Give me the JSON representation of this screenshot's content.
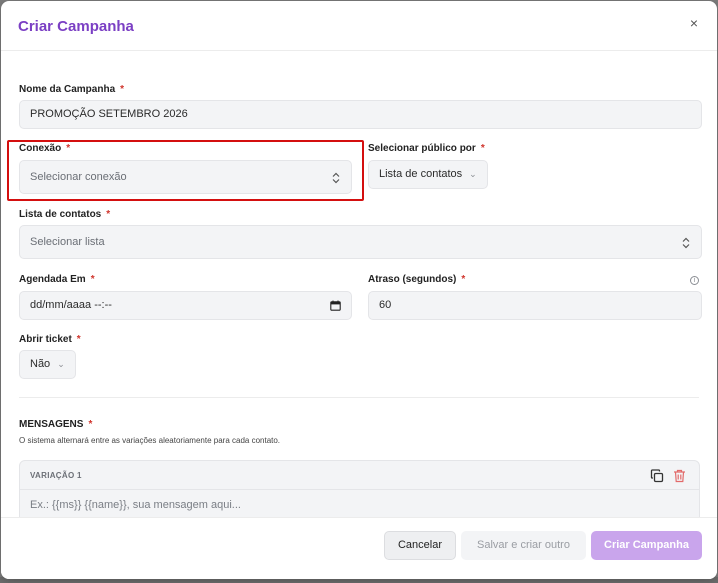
{
  "modal": {
    "title": "Criar Campanha",
    "close_label": "×"
  },
  "form": {
    "campaign_name": {
      "label": "Nome da Campanha",
      "required": "*",
      "value": "PROMOÇÃO SETEMBRO 2026"
    },
    "connection": {
      "label": "Conexão",
      "required": "*",
      "placeholder": "Selecionar conexão"
    },
    "audience_by": {
      "label": "Selecionar público por",
      "required": "*",
      "value": "Lista de contatos"
    },
    "contact_list": {
      "label": "Lista de contatos",
      "required": "*",
      "placeholder": "Selecionar lista"
    },
    "scheduled_at": {
      "label": "Agendada Em",
      "required": "*",
      "placeholder": "dd/mm/aaaa --:--"
    },
    "delay": {
      "label": "Atraso (segundos)",
      "required": "*",
      "value": "60",
      "info": "i"
    },
    "open_ticket": {
      "label": "Abrir ticket",
      "required": "*",
      "value": "Não"
    }
  },
  "messages": {
    "title": "MENSAGENS",
    "required": "*",
    "description": "O sistema alternará entre as variações aleatoriamente para cada contato.",
    "variations": [
      {
        "title": "VARIAÇÃO 1",
        "placeholder": "Ex.: {{ms}} {{name}}, sua mensagem aqui..."
      }
    ]
  },
  "footer": {
    "cancel_label": "Cancelar",
    "save_new_label": "Salvar e criar outro",
    "create_label": "Criar Campanha"
  },
  "colors": {
    "accent": "#7b3fc4",
    "create_button": "#c9a5ec",
    "highlight": "#d40f0f",
    "required": "#d0342c"
  }
}
